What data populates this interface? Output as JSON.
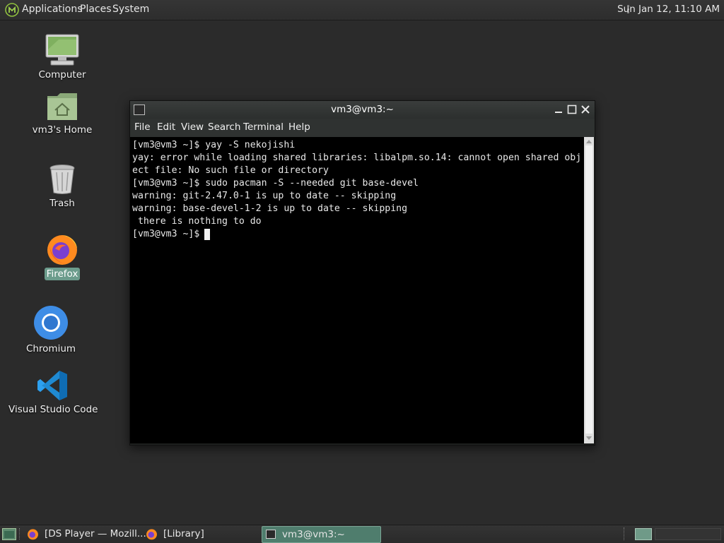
{
  "top_panel": {
    "menus": [
      "Applications",
      "Places",
      "System"
    ],
    "clock": "Sun Jan 12, 11:10 AM"
  },
  "desktop": {
    "icons": [
      {
        "label": "Computer",
        "icon": "computer-icon"
      },
      {
        "label": "vm3's Home",
        "icon": "home-folder-icon"
      },
      {
        "label": "Trash",
        "icon": "trash-icon"
      },
      {
        "label": "Firefox",
        "icon": "firefox-icon",
        "selected": true
      },
      {
        "label": "Chromium",
        "icon": "chromium-icon"
      },
      {
        "label": "Visual Studio Code",
        "icon": "vscode-icon"
      }
    ]
  },
  "terminal": {
    "title": "vm3@vm3:~",
    "menu": [
      "File",
      "Edit",
      "View",
      "Search",
      "Terminal",
      "Help"
    ],
    "lines": [
      "[vm3@vm3 ~]$ yay -S nekojishi",
      "yay: error while loading shared libraries: libalpm.so.14: cannot open shared obj",
      "ect file: No such file or directory",
      "[vm3@vm3 ~]$ sudo pacman -S --needed git base-devel",
      "warning: git-2.47.0-1 is up to date -- skipping",
      "warning: base-devel-1-2 is up to date -- skipping",
      " there is nothing to do",
      "[vm3@vm3 ~]$ "
    ]
  },
  "taskbar": {
    "tasks": [
      {
        "label": "[DS Player — Mozill...",
        "icon": "firefox-icon"
      },
      {
        "label": "[Library]",
        "icon": "firefox-icon"
      },
      {
        "label": "vm3@vm3:~",
        "icon": "terminal-icon",
        "active": true
      }
    ]
  },
  "colors": {
    "desktop_bg": "#2b2b2b",
    "accent": "#4f7d6d",
    "selection": "#6c9c8c",
    "terminal_bg": "#000000"
  }
}
